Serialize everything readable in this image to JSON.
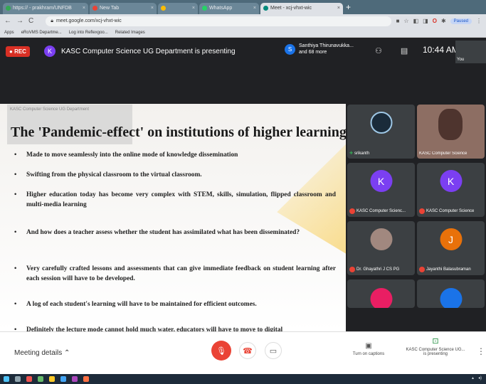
{
  "browser": {
    "tabs": [
      {
        "label": "https:// - prakhram/UNFDB",
        "color": "#34a853"
      },
      {
        "label": "New Tab",
        "color": "#ea4335"
      },
      {
        "label": "",
        "color": "#fbbc05"
      },
      {
        "label": "WhatsApp",
        "color": "#25d366"
      },
      {
        "label": "Meet - xcj-vhxt-wic",
        "color": "#00897b"
      }
    ],
    "new_tab": "+",
    "url": "meet.google.com/xcj-vhxt-wic",
    "profile": "Paused",
    "bookmarks": [
      "Apps",
      "eRoVMS Departme...",
      "Log into Reflexgoo...",
      "Related Images"
    ]
  },
  "meet": {
    "rec": "REC",
    "presenter_initial": "K",
    "presenting_text": "KASC Computer Science UG Department is presenting",
    "share_initial": "S",
    "share_name": "Santhiya Thirunavukka...",
    "share_more": "and 68 more",
    "time": "10:44 AM",
    "self_label": "You",
    "slide_ghost": "KASC Computer Science UG Department",
    "slide": {
      "title": "The 'Pandemic-effect' on institutions of higher learning",
      "bullets": [
        "Made to move seamlessly into the online mode of knowledge dissemination",
        "Swifting from the physical classroom to the virtual classroom.",
        "Higher education today has become very complex with STEM, skills, simulation, flipped classroom and multi-media learning",
        "And how does a teacher assess whether the student has assimilated what has been disseminated?",
        "Very carefully crafted lessons and assessments that can give immediate feedback on student learning after each session will have to be developed.",
        "A log of each student's learning will have to be maintained for efficient outcomes.",
        "Definitely the lecture mode cannot hold much water, educators will have to move to digital"
      ]
    },
    "participants": [
      {
        "name": "srikanth",
        "type": "photo",
        "color": "#1a2b3a"
      },
      {
        "name": "KASC Computer Science",
        "type": "camera",
        "color": "#8d6e63"
      },
      {
        "name": "KASC Computer Scienc...",
        "initial": "K",
        "type": "avatar",
        "color": "#7b3ff2"
      },
      {
        "name": "KASC Computer Science",
        "initial": "K",
        "type": "avatar",
        "color": "#7b3ff2"
      },
      {
        "name": "Dr. Ghayathri J CS PG",
        "type": "photo",
        "color": "#a1887f"
      },
      {
        "name": "Jayanthi Balasubraman",
        "initial": "J",
        "type": "avatar",
        "color": "#e8710a"
      }
    ],
    "bottom": {
      "meeting_details": "Meeting details",
      "captions": "Turn on captions",
      "presenting_line1": "KASC Computer Science UG...",
      "presenting_line2": "is presenting"
    }
  },
  "colors": {
    "accent": "#1a73e8",
    "danger": "#ea4335",
    "rec": "#d93025",
    "meet_bg": "#202124"
  },
  "icons": [
    "mic-off-icon",
    "hangup-icon",
    "present-icon",
    "captions-icon",
    "participants-icon",
    "chat-icon",
    "more-icon"
  ]
}
